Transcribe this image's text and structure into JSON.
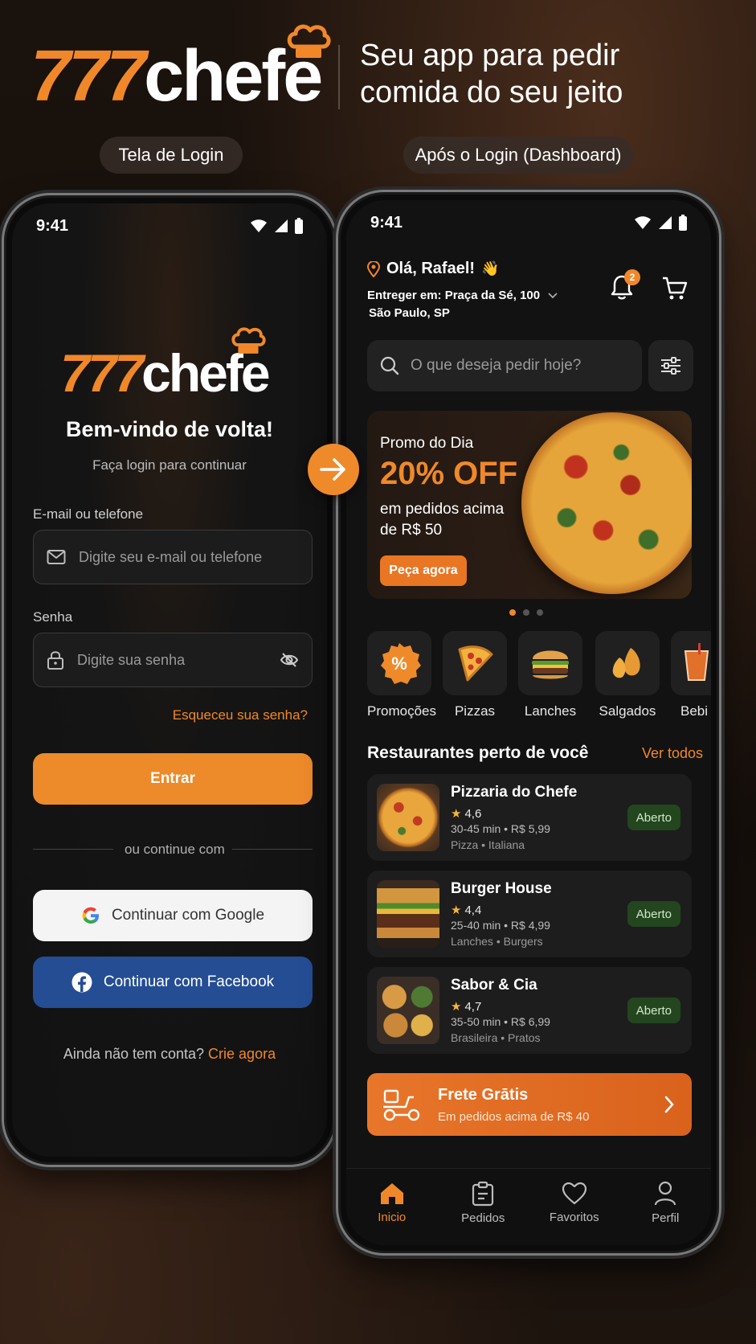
{
  "header": {
    "brand_number": "777",
    "brand_word": "chefe",
    "tagline_line1": "Seu app para pedir",
    "tagline_line2": "comida do seu jeito",
    "label_login": "Tela de Login",
    "label_dashboard": "Após o Login (Dashboard)"
  },
  "colors": {
    "accent": "#f0882a",
    "background": "#131313",
    "facebook": "#244d94",
    "open_badge": "#23461f"
  },
  "login": {
    "time": "9:41",
    "brand_number": "777",
    "brand_word": "chefe",
    "title": "Bem-vindo de volta!",
    "subtitle": "Faça login para continuar",
    "email_label": "E-mail ou telefone",
    "email_placeholder": "Digite seu e-mail ou telefone",
    "password_label": "Senha",
    "password_placeholder": "Digite sua senha",
    "forgot": "Esqueceu sua senha?",
    "submit": "Entrar",
    "or_continue": "ou continue com",
    "google": "Continuar com Google",
    "facebook": "Continuar com Facebook",
    "no_account": "Ainda não tem conta?",
    "create": "Crie agora"
  },
  "dashboard": {
    "time": "9:41",
    "greeting": "Olá, Rafael!",
    "wave": "👋",
    "deliver_to": "Entreger em: Praça da Sé, 100",
    "city": "São Paulo, SP",
    "notifications_count": "2",
    "search_placeholder": "O que deseja pedir hoje?",
    "promo": {
      "kicker": "Promo do Dia",
      "headline": "20% OFF",
      "line1": "em pedidos acima",
      "line2": "de R$ 50",
      "cta": "Peça agora"
    },
    "carousel_active_index": 0,
    "categories": [
      {
        "label": "Promoções",
        "icon": "percent-badge-icon"
      },
      {
        "label": "Pizzas",
        "icon": "pizza-slice-icon"
      },
      {
        "label": "Lanches",
        "icon": "burger-icon"
      },
      {
        "label": "Salgados",
        "icon": "coxinha-icon"
      },
      {
        "label": "Bebi",
        "icon": "drink-icon"
      }
    ],
    "section_title": "Restaurantes perto de você",
    "see_all": "Ver todos",
    "restaurants": [
      {
        "name": "Pizzaria do Chefe",
        "rating": "4,6",
        "meta": "30-45 min • R$ 5,99",
        "tags": "Pizza • Italiana",
        "status": "Aberto"
      },
      {
        "name": "Burger House",
        "rating": "4,4",
        "meta": "25-40 min • R$ 4,99",
        "tags": "Lanches • Burgers",
        "status": "Aberto"
      },
      {
        "name": "Sabor & Cia",
        "rating": "4,7",
        "meta": "35-50 min • R$ 6,99",
        "tags": "Brasileira • Pratos",
        "status": "Aberto"
      }
    ],
    "free_delivery": {
      "title": "Frete Grātis",
      "subtitle": "Em pedidos acima de R$ 40"
    },
    "nav": [
      {
        "label": "Inicio",
        "icon": "home-icon",
        "active": true
      },
      {
        "label": "Pedidos",
        "icon": "clipboard-icon",
        "active": false
      },
      {
        "label": "Favoritos",
        "icon": "heart-icon",
        "active": false
      },
      {
        "label": "Perfil",
        "icon": "user-icon",
        "active": false
      }
    ]
  }
}
